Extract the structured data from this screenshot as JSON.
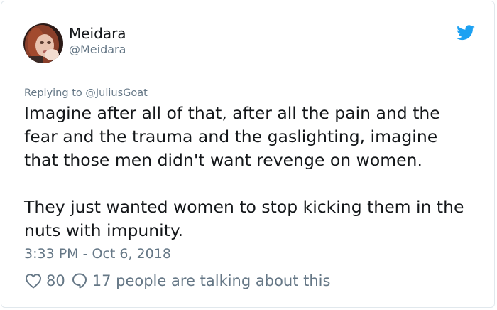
{
  "tweet": {
    "display_name": "Meidara",
    "handle": "@Meidara",
    "reply_prefix": "Replying to",
    "reply_to": "@JuliusGoat",
    "paragraphs": [
      "Imagine after all of that, after all the pain and the\nfear and the trauma and the gaslighting, imagine\nthat those men didn't want revenge on women.",
      "They just wanted women to stop kicking them in the\nnuts with impunity."
    ],
    "timestamp": "3:33 PM - Oct 6, 2018",
    "likes": "80",
    "talking": "17 people are talking about this"
  },
  "icons": {
    "brand": "twitter-bird-icon",
    "like": "heart-icon",
    "reply": "speech-bubble-icon"
  },
  "colors": {
    "brand": "#1da1f2",
    "text": "#14171a",
    "muted": "#657786",
    "border": "#e1e8ed"
  }
}
